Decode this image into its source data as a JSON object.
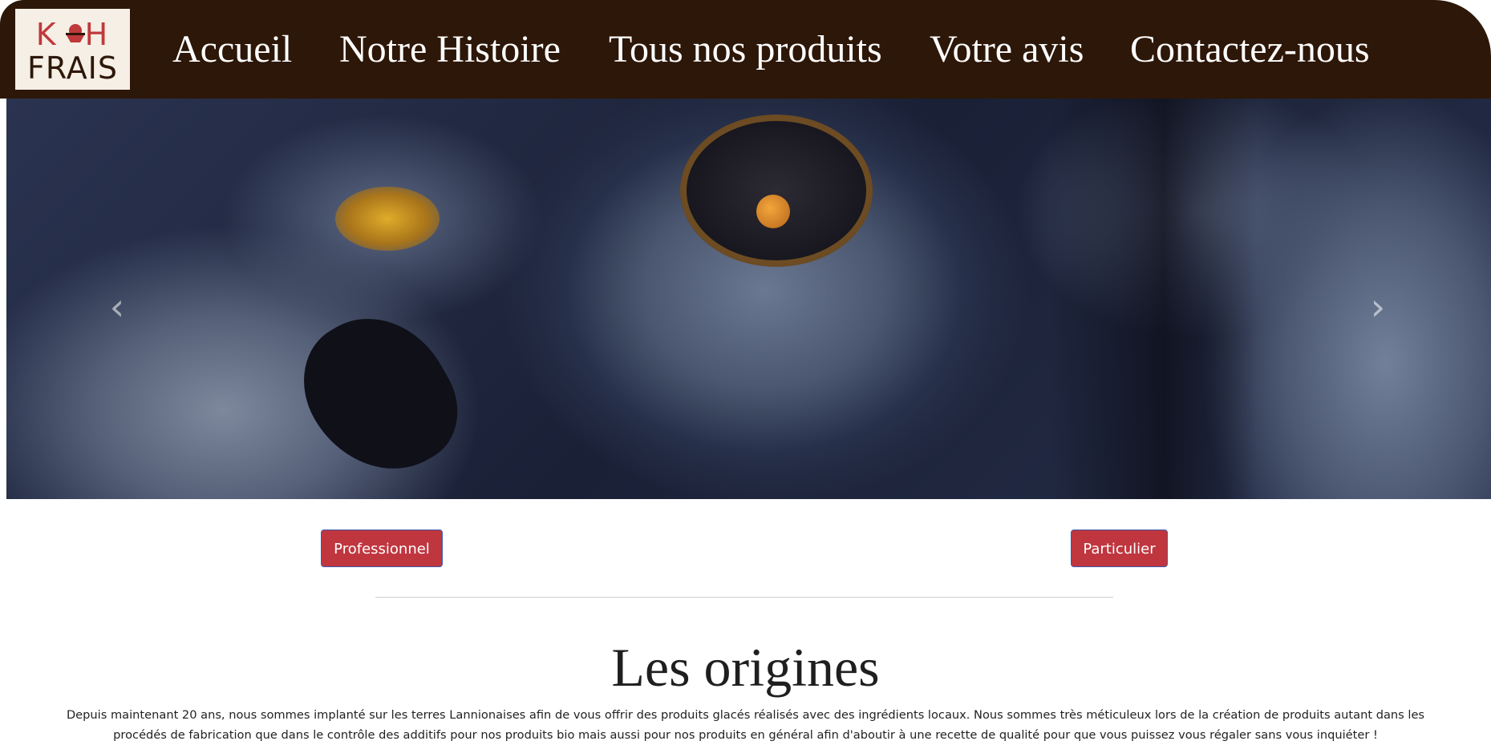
{
  "logo": {
    "line1_left": "K",
    "line1_right": "H",
    "line2": "FRAIS",
    "icon": "ice-cream-bowl-icon"
  },
  "nav": {
    "items": [
      {
        "label": "Accueil"
      },
      {
        "label": "Notre Histoire"
      },
      {
        "label": "Tous nos produits"
      },
      {
        "label": "Votre avis"
      },
      {
        "label": "Contactez-nous"
      }
    ]
  },
  "carousel": {
    "prev_icon": "chevron-left-icon",
    "next_icon": "chevron-right-icon",
    "prev_glyph": "‹",
    "next_glyph": "›"
  },
  "buttons": {
    "professional": "Professionnel",
    "individual": "Particulier"
  },
  "origins": {
    "title": "Les origines",
    "text": "Depuis maintenant 20 ans, nous sommes implanté sur les terres Lannionaises afin de vous offrir des produits glacés réalisés avec des ingrédients locaux. Nous sommes très méticuleux lors de la création de produits autant dans les procédés de fabrication que dans le contrôle des additifs pour nos produits bio mais aussi pour nos produits en général afin d'aboutir à une recette de qualité pour que vous puissez vous régaler sans vous inquiéter !"
  },
  "colors": {
    "navbar_bg": "#2d1708",
    "button_bg": "#c0363f",
    "logo_red": "#c0393b"
  }
}
